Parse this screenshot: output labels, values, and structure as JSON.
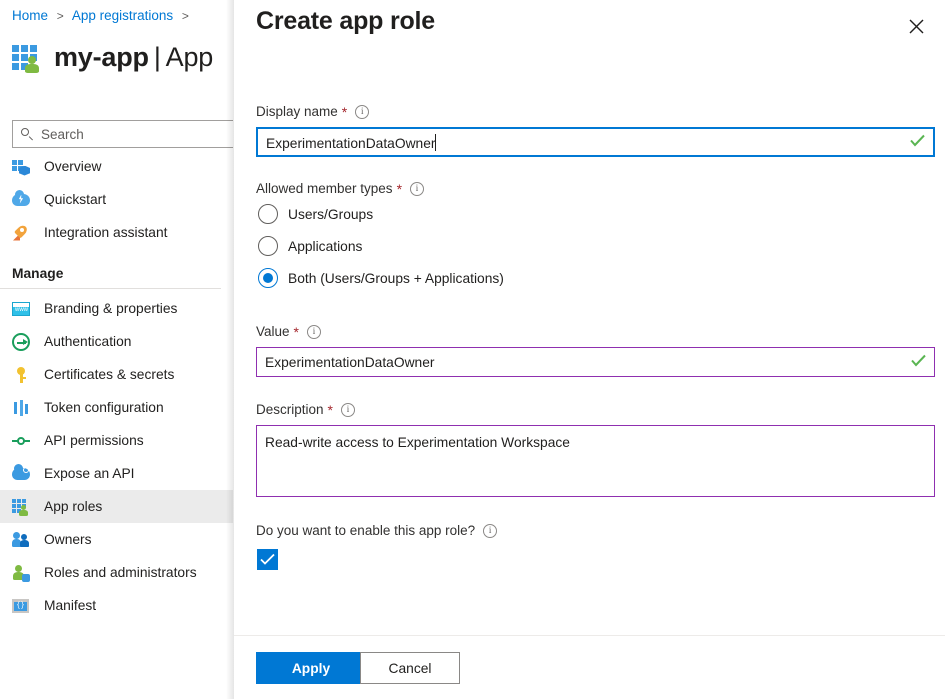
{
  "background": {
    "breadcrumb": {
      "items": [
        "Home",
        "App registrations"
      ],
      "separator": ">"
    },
    "page_title": {
      "name": "my-app",
      "divider": "|",
      "section": "App"
    },
    "search": {
      "placeholder": "Search",
      "icon": "search-icon"
    },
    "nav": {
      "items": [
        {
          "label": "Overview",
          "icon": "overview-icon",
          "selected": false
        },
        {
          "label": "Quickstart",
          "icon": "quickstart-cloud-icon",
          "selected": false
        },
        {
          "label": "Integration assistant",
          "icon": "rocket-icon",
          "selected": false
        }
      ],
      "section_label": "Manage",
      "manage_items": [
        {
          "label": "Branding & properties",
          "icon": "branding-icon",
          "selected": false
        },
        {
          "label": "Authentication",
          "icon": "authentication-icon",
          "selected": false
        },
        {
          "label": "Certificates & secrets",
          "icon": "key-icon",
          "selected": false
        },
        {
          "label": "Token configuration",
          "icon": "token-icon",
          "selected": false
        },
        {
          "label": "API permissions",
          "icon": "api-permissions-icon",
          "selected": false
        },
        {
          "label": "Expose an API",
          "icon": "expose-api-icon",
          "selected": false
        },
        {
          "label": "App roles",
          "icon": "app-roles-icon",
          "selected": true
        },
        {
          "label": "Owners",
          "icon": "owners-icon",
          "selected": false
        },
        {
          "label": "Roles and administrators",
          "icon": "roles-administrators-icon",
          "selected": false
        },
        {
          "label": "Manifest",
          "icon": "manifest-icon",
          "selected": false
        }
      ]
    }
  },
  "panel": {
    "title": "Create app role",
    "close_icon": "close-icon",
    "fields": {
      "display_name": {
        "label": "Display name",
        "required_marker": "*",
        "info_icon": "info-icon",
        "value": "ExperimentationDataOwner",
        "validation_icon": "checkmark-icon",
        "state": "focused"
      },
      "allowed_member_types": {
        "label": "Allowed member types",
        "required_marker": "*",
        "info_icon": "info-icon",
        "options": [
          {
            "label": "Users/Groups",
            "checked": false
          },
          {
            "label": "Applications",
            "checked": false
          },
          {
            "label": "Both (Users/Groups + Applications)",
            "checked": true
          }
        ]
      },
      "value": {
        "label": "Value",
        "required_marker": "*",
        "info_icon": "info-icon",
        "value": "ExperimentationDataOwner",
        "validation_icon": "checkmark-icon",
        "state": "modified"
      },
      "description": {
        "label": "Description",
        "required_marker": "*",
        "info_icon": "info-icon",
        "value": "Read-write access to Experimentation Workspace",
        "state": "modified"
      },
      "enable_role": {
        "label": "Do you want to enable this app role?",
        "info_icon": "info-icon",
        "checked": true,
        "check_icon": "checkmark-icon"
      }
    },
    "footer": {
      "apply_label": "Apply",
      "cancel_label": "Cancel"
    }
  },
  "colors": {
    "accent": "#0078d4",
    "link": "#0078d4",
    "required": "#a4262c",
    "modified_border": "#8f2fb0",
    "success": "#5ab552",
    "selected_row": "#ebebeb"
  }
}
